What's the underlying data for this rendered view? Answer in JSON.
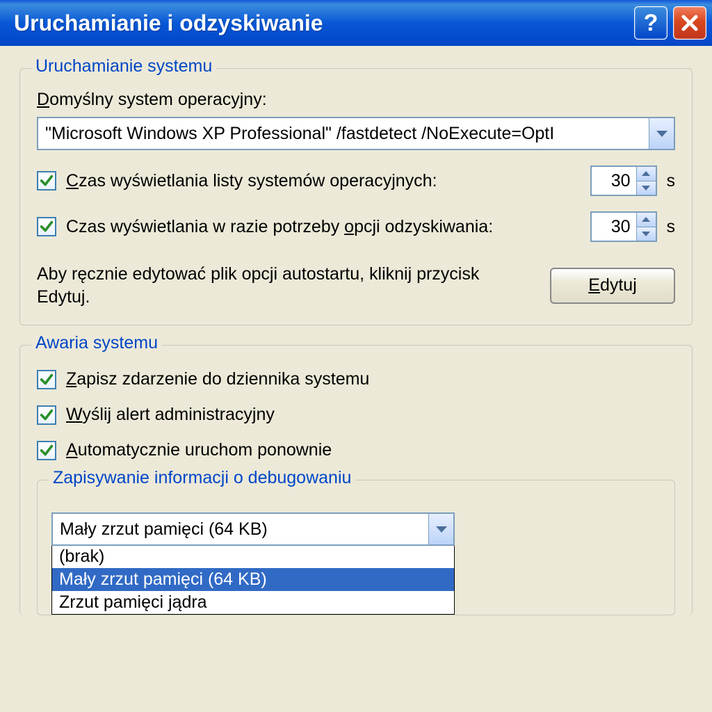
{
  "title": "Uruchamianie i odzyskiwanie",
  "startup": {
    "legend": "Uruchamianie systemu",
    "default_os_label": "Domyślny system operacyjny:",
    "default_os_value": "\"Microsoft Windows XP Professional\" /fastdetect /NoExecute=OptI",
    "checkbox1_label": "Czas wyświetlania listy systemów operacyjnych:",
    "checkbox1_value": 30,
    "unit": "s",
    "checkbox2_label": "Czas wyświetlania w razie potrzeby opcji odzyskiwania:",
    "checkbox2_value": 30,
    "edit_text": "Aby ręcznie edytować plik opcji autostartu, kliknij przycisk Edytuj.",
    "edit_button": "Edytuj"
  },
  "failure": {
    "legend": "Awaria systemu",
    "cb_log": "Zapisz zdarzenie do dziennika systemu",
    "cb_alert": "Wyślij alert administracyjny",
    "cb_restart": "Automatycznie uruchom ponownie",
    "debug_legend": "Zapisywanie informacji o debugowaniu",
    "dump_selected": "Mały zrzut pamięci (64 KB)",
    "dump_options": [
      "(brak)",
      "Mały zrzut pamięci (64 KB)",
      "Zrzut pamięci jądra"
    ]
  }
}
